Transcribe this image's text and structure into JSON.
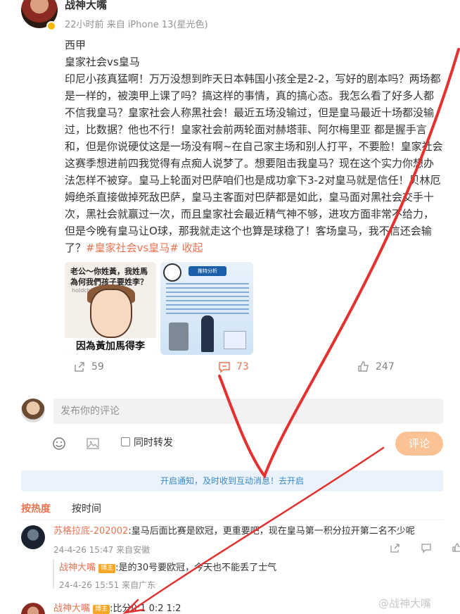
{
  "post": {
    "author": "战神大嘴",
    "time": "22小时前",
    "source": "来自 iPhone 13(星光色)",
    "league": "西甲",
    "match": "皇家社会vs皇马",
    "body": "印尼小孩真猛啊！万万没想到昨天日本韩国小孩全是2-2，写好的剧本吗？两场都是一样的，被澳甲上课了吗？搞这样的事情，真的搞心态。我怎么看了好多人都不信我皇马？皇家社会人称黑社会！最近五场没输过，但是皇马最近十场都没输过，比数据？他也不行！皇家社会前两轮面对赫塔菲、阿尔梅里亚 都是握手言和，但是你说硬仗这是一场没有啊~在自己家主场和别人打平，不要脸！皇家社会这赛季想进前四我觉得有点痴人说梦了。想要阻击我皇马？现在这个实力你想办法怎样不被穿。皇马上轮面对巴萨咱们也是成功拿下3-2对皇马就是信任！贝林厄姆绝杀直接做掉死敌巴萨，皇马主客面对巴萨都是如此，皇马面对黑社会交手十次，黑社会就赢过一次，而且皇家社会最近精气神不够，进攻方面非常不给力，但是今晚有皇马让O球，那我就走这个也算是球稳了！客场皇马，我不信还会输了？",
    "hashtag": "#皇家社会vs皇马#",
    "collapse": "收起"
  },
  "images": {
    "img1_title": "老公～你姓黃，我姓馬\n為何我們孩子要姓李？",
    "img1_watermark": "holdchiou",
    "img1_caption": "因為黃加馬得李",
    "img2_header": "推特分析"
  },
  "actions": {
    "share_count": "59",
    "comment_count": "73",
    "like_count": "247"
  },
  "comment_box": {
    "placeholder": "发布你的评论",
    "forward_label": "同时转发",
    "submit_label": "评论"
  },
  "notice": "开启通知，及时收到互动消息！去开启",
  "sort": {
    "hot": "按热度",
    "time": "按时间"
  },
  "comments": [
    {
      "name": "苏格拉底-202002",
      "text": ":皇马后面比赛是欧冠，更重要吧，现在皇马第一积分拉开第二名不少呢",
      "time": "24-4-26 15:47",
      "source": "来自安徽"
    },
    {
      "name": "战神大嘴",
      "badge": "博主",
      "text": ":是的30号要欧冠，今天也不能丢了士气",
      "time": "24-4-26 15:51",
      "source": "来自广东"
    },
    {
      "name": "战神大嘴",
      "badge": "博主",
      "text": ":比分0:1  0:2 1:2"
    }
  ],
  "watermark": "@战神大嘴",
  "colors": {
    "accent": "#eb7350",
    "link": "#3b87c8",
    "annotation": "#e53030"
  }
}
